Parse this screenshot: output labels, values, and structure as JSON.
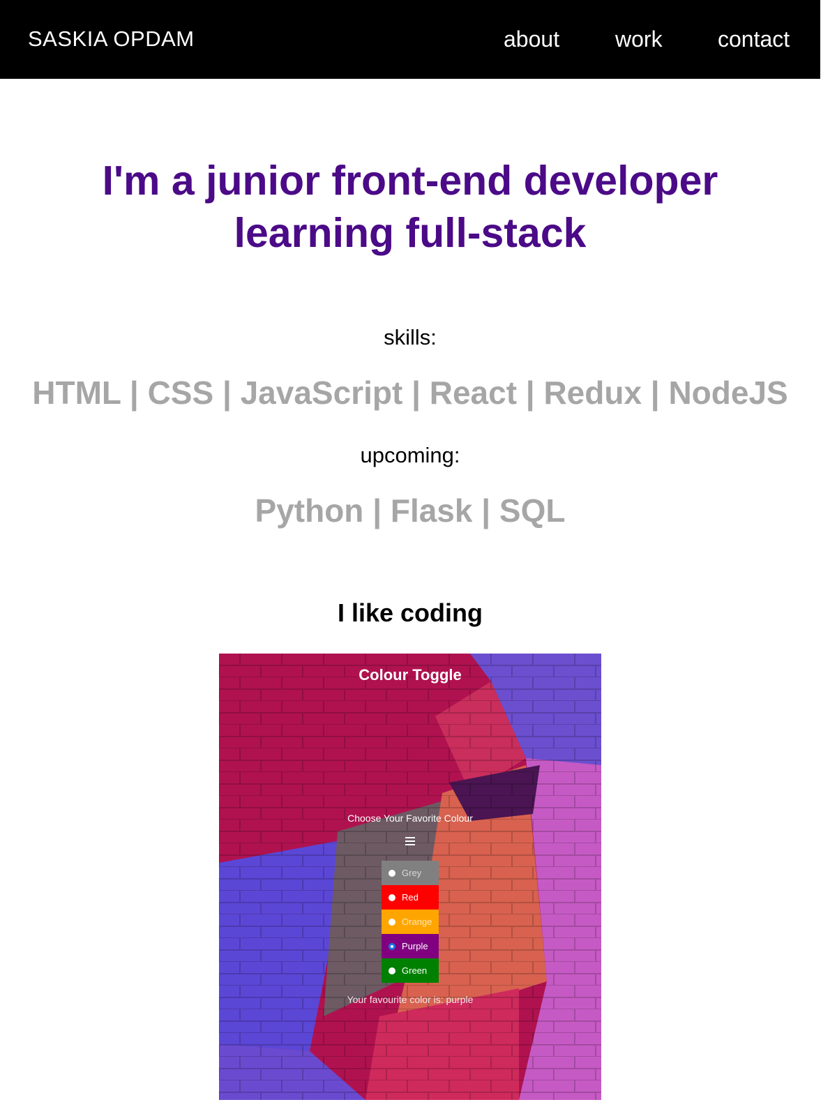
{
  "nav": {
    "brand": "SASKIA OPDAM",
    "links": [
      "about",
      "work",
      "contact"
    ]
  },
  "hero": {
    "title_line1": "I'm a junior front-end developer",
    "title_line2": "learning full-stack"
  },
  "skills": {
    "label": "skills:",
    "list": "HTML | CSS | JavaScript | React | Redux | NodeJS"
  },
  "upcoming": {
    "label": "upcoming:",
    "list": "Python | Flask | SQL"
  },
  "coding": {
    "heading": "I like coding"
  },
  "project": {
    "app_title": "Colour Toggle",
    "prompt": "Choose Your Favorite Colour",
    "menu_icon": "hamburger-menu-icon",
    "options": [
      {
        "label": "Grey",
        "bg": "#808080",
        "text": "#d9d9d9",
        "checked": false
      },
      {
        "label": "Red",
        "bg": "#ff0000",
        "text": "#ffffff",
        "checked": false
      },
      {
        "label": "Orange",
        "bg": "#ffa500",
        "text": "#ffe6b3",
        "checked": false
      },
      {
        "label": "Purple",
        "bg": "#800080",
        "text": "#ffffff",
        "checked": true
      },
      {
        "label": "Green",
        "bg": "#008000",
        "text": "#ffffff",
        "checked": false
      }
    ],
    "result": "Your favourite color is: purple"
  },
  "colors": {
    "navbar_bg": "#000000",
    "accent": "#4b0a87",
    "skill_text": "#a6a6a6"
  }
}
